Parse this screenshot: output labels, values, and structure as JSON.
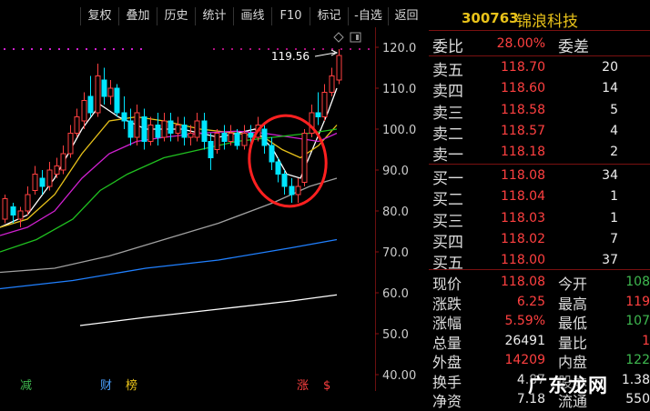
{
  "toolbar": {
    "items": [
      "复权",
      "叠加",
      "历史",
      "统计",
      "画线",
      "F10",
      "标记",
      "-自选",
      "返回"
    ]
  },
  "chart": {
    "y_ticks": [
      "120.0",
      "110.0",
      "100.0",
      "90.0",
      "80.0",
      "70.0",
      "60.0",
      "50.0",
      "40.00"
    ],
    "high_label": "119.56",
    "bottom_markers": [
      {
        "text": "减",
        "color": "#3fb950"
      },
      {
        "text": "财",
        "color": "#4aa0ff"
      },
      {
        "text": "榜",
        "color": "#e8c21a"
      },
      {
        "text": "涨",
        "color": "#ff4040"
      },
      {
        "text": "$",
        "color": "#ff4040"
      }
    ]
  },
  "stock": {
    "code": "300763",
    "name": "锦浪科技"
  },
  "order_ratio": {
    "label": "委比",
    "value": "28.00%",
    "label2": "委差"
  },
  "asks": [
    {
      "label": "卖五",
      "price": "118.70",
      "vol": "20"
    },
    {
      "label": "卖四",
      "price": "118.60",
      "vol": "14"
    },
    {
      "label": "卖三",
      "price": "118.58",
      "vol": "5"
    },
    {
      "label": "卖二",
      "price": "118.57",
      "vol": "4"
    },
    {
      "label": "卖一",
      "price": "118.18",
      "vol": "2"
    }
  ],
  "bids": [
    {
      "label": "买一",
      "price": "118.08",
      "vol": "34"
    },
    {
      "label": "买二",
      "price": "118.04",
      "vol": "1"
    },
    {
      "label": "买三",
      "price": "118.03",
      "vol": "1"
    },
    {
      "label": "买四",
      "price": "118.02",
      "vol": "7"
    },
    {
      "label": "买五",
      "price": "118.00",
      "vol": "37"
    }
  ],
  "stats": [
    {
      "l1": "现价",
      "v1": "118.08",
      "c1": "#ff4040",
      "l2": "今开",
      "v2": "108",
      "c2": "#3fb950"
    },
    {
      "l1": "涨跌",
      "v1": "6.25",
      "c1": "#ff4040",
      "l2": "最高",
      "v2": "119",
      "c2": "#ff4040"
    },
    {
      "l1": "涨幅",
      "v1": "5.59%",
      "c1": "#ff4040",
      "l2": "最低",
      "v2": "107",
      "c2": "#3fb950"
    },
    {
      "l1": "总量",
      "v1": "26491",
      "c1": "#eeeeee",
      "l2": "量比",
      "v2": "1",
      "c2": "#ff4040"
    },
    {
      "l1": "外盘",
      "v1": "14209",
      "c1": "#ff4040",
      "l2": "内盘",
      "v2": "122",
      "c2": "#3fb950"
    },
    {
      "l1": "换手",
      "v1": "4.87",
      "c1": "#eeeeee",
      "l2": "股本",
      "v2": "1.38",
      "c2": "#eeeeee"
    },
    {
      "l1": "净资",
      "v1": "7.18",
      "c1": "#eeeeee",
      "l2": "流通",
      "v2": "550",
      "c2": "#eeeeee"
    }
  ],
  "watermark": "广东龙网",
  "colors": {
    "up": "#ff4040",
    "down": "#00e5ff",
    "ma5": "#ffffff",
    "ma10": "#e8c21a",
    "ma20": "#d020d0",
    "ma30": "#20c020",
    "ma60": "#a0a0a0",
    "ma120": "#2080ff",
    "ma250": "#ffffff",
    "circle": "#ff2020"
  }
}
